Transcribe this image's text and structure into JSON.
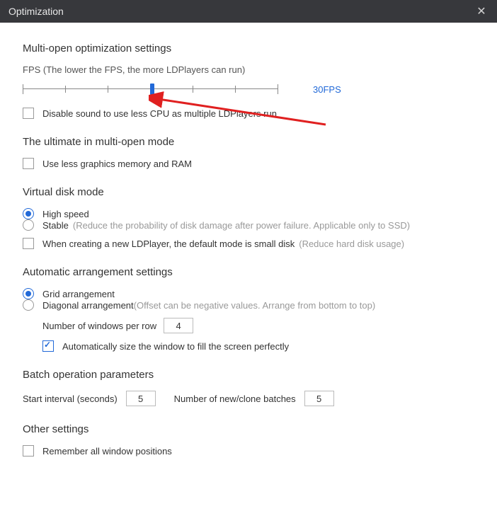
{
  "titlebar": {
    "title": "Optimization",
    "close_symbol": "✕"
  },
  "multi_open": {
    "title": "Multi-open optimization settings",
    "fps_label": "FPS (The lower the FPS, the more LDPlayers can run)",
    "fps_value_label": "30FPS",
    "slider_value_percent": 50,
    "disable_sound_label": "Disable sound to use less CPU as multiple LDPlayers run"
  },
  "ultimate": {
    "title": "The ultimate in multi-open mode",
    "less_graphics_label": "Use less graphics memory and RAM"
  },
  "virtual_disk": {
    "title": "Virtual disk mode",
    "high_speed_label": "High speed",
    "stable_label": "Stable",
    "stable_hint": "(Reduce the probability of disk damage after power failure. Applicable only to SSD)",
    "small_disk_label": "When creating a new LDPlayer, the default mode is small disk",
    "small_disk_hint": "(Reduce hard disk usage)"
  },
  "arrangement": {
    "title": "Automatic arrangement settings",
    "grid_label": "Grid arrangement",
    "diagonal_label": "Diagonal arrangement",
    "diagonal_hint": "(Offset can be negative values. Arrange from bottom to top)",
    "windows_per_row_label": "Number of windows per row",
    "windows_per_row": "4",
    "auto_size_label": "Automatically size the window to fill the screen perfectly"
  },
  "batch": {
    "title": "Batch operation parameters",
    "start_interval_label": "Start interval (seconds)",
    "start_interval": "5",
    "batches_label": "Number of new/clone batches",
    "batches": "5"
  },
  "other": {
    "title": "Other settings",
    "remember_label": "Remember all window positions"
  }
}
